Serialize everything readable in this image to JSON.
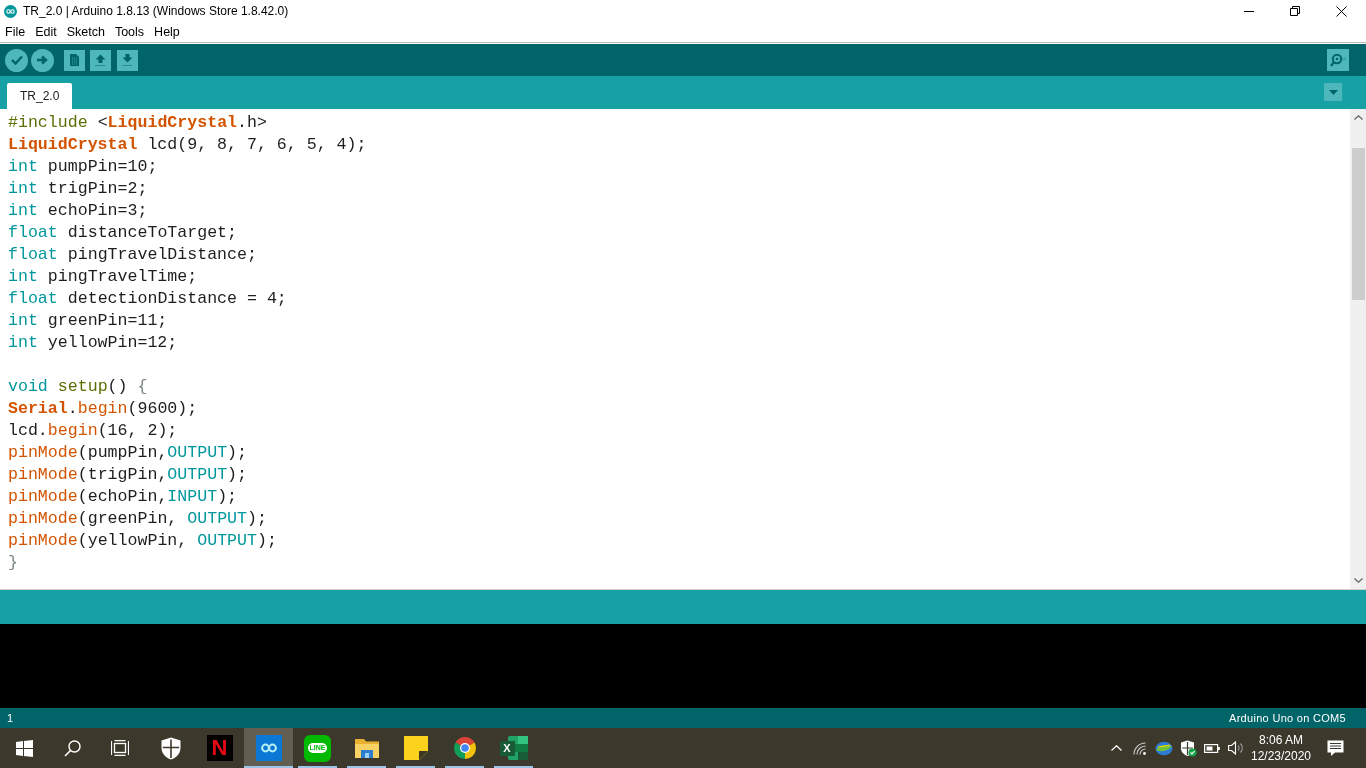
{
  "window": {
    "title": "TR_2.0 | Arduino 1.8.13 (Windows Store 1.8.42.0)"
  },
  "menu": [
    {
      "label": "File"
    },
    {
      "label": "Edit"
    },
    {
      "label": "Sketch"
    },
    {
      "label": "Tools"
    },
    {
      "label": "Help"
    }
  ],
  "tabs": [
    {
      "label": "TR_2.0",
      "selected": true
    }
  ],
  "editor": {
    "blocks": [
      {
        "lines": [
          {
            "tokens": [
              {
                "text": "#include",
                "kind": "directive"
              },
              {
                "text": " <",
                "kind": "plain"
              },
              {
                "text": "LiquidCrystal",
                "kind": "class"
              },
              {
                "text": ".h>",
                "kind": "plain"
              }
            ]
          },
          {
            "tokens": [
              {
                "text": "LiquidCrystal",
                "kind": "class"
              },
              {
                "text": " lcd(9, 8, 7, 6, 5, 4);",
                "kind": "plain"
              }
            ]
          },
          {
            "tokens": [
              {
                "text": "int",
                "kind": "type"
              },
              {
                "text": " pumpPin=10;",
                "kind": "plain"
              }
            ]
          },
          {
            "tokens": [
              {
                "text": "int",
                "kind": "type"
              },
              {
                "text": " trigPin=2;",
                "kind": "plain"
              }
            ]
          },
          {
            "tokens": [
              {
                "text": "int",
                "kind": "type"
              },
              {
                "text": " echoPin=3;",
                "kind": "plain"
              }
            ]
          },
          {
            "tokens": [
              {
                "text": "float",
                "kind": "type"
              },
              {
                "text": " distanceToTarget;",
                "kind": "plain"
              }
            ]
          },
          {
            "tokens": [
              {
                "text": "float",
                "kind": "type"
              },
              {
                "text": " pingTravelDistance;",
                "kind": "plain"
              }
            ]
          },
          {
            "tokens": [
              {
                "text": "int",
                "kind": "type"
              },
              {
                "text": " pingTravelTime;",
                "kind": "plain"
              }
            ]
          },
          {
            "tokens": [
              {
                "text": "float",
                "kind": "type"
              },
              {
                "text": " detectionDistance = 4;",
                "kind": "plain"
              }
            ]
          },
          {
            "tokens": [
              {
                "text": "int",
                "kind": "type"
              },
              {
                "text": " greenPin=11;",
                "kind": "plain"
              }
            ]
          },
          {
            "tokens": [
              {
                "text": "int",
                "kind": "type"
              },
              {
                "text": " yellowPin=12;",
                "kind": "plain"
              }
            ]
          }
        ]
      },
      {
        "lines": [
          {
            "tokens": [
              {
                "text": "void",
                "kind": "type"
              },
              {
                "text": " setup",
                "kind": "sketch_function"
              },
              {
                "text": "() ",
                "kind": "plain"
              },
              {
                "text": "{",
                "kind": "bracket"
              }
            ]
          },
          {
            "tokens": [
              {
                "text": "Serial",
                "kind": "class"
              },
              {
                "text": ".",
                "kind": "plain"
              },
              {
                "text": "begin",
                "kind": "function"
              },
              {
                "text": "(9600);",
                "kind": "plain"
              }
            ]
          },
          {
            "tokens": [
              {
                "text": "lcd.",
                "kind": "plain"
              },
              {
                "text": "begin",
                "kind": "function"
              },
              {
                "text": "(16, 2);",
                "kind": "plain"
              }
            ]
          },
          {
            "tokens": [
              {
                "text": "pinMode",
                "kind": "function"
              },
              {
                "text": "(pumpPin,",
                "kind": "plain"
              },
              {
                "text": "OUTPUT",
                "kind": "constant"
              },
              {
                "text": ");",
                "kind": "plain"
              }
            ]
          },
          {
            "tokens": [
              {
                "text": "pinMode",
                "kind": "function"
              },
              {
                "text": "(trigPin,",
                "kind": "plain"
              },
              {
                "text": "OUTPUT",
                "kind": "constant"
              },
              {
                "text": ");",
                "kind": "plain"
              }
            ]
          },
          {
            "tokens": [
              {
                "text": "pinMode",
                "kind": "function"
              },
              {
                "text": "(echoPin,",
                "kind": "plain"
              },
              {
                "text": "INPUT",
                "kind": "constant"
              },
              {
                "text": ");",
                "kind": "plain"
              }
            ]
          },
          {
            "tokens": [
              {
                "text": "pinMode",
                "kind": "function"
              },
              {
                "text": "(greenPin, ",
                "kind": "plain"
              },
              {
                "text": "OUTPUT",
                "kind": "constant"
              },
              {
                "text": ");",
                "kind": "plain"
              }
            ]
          },
          {
            "tokens": [
              {
                "text": "pinMode",
                "kind": "function"
              },
              {
                "text": "(yellowPin, ",
                "kind": "plain"
              },
              {
                "text": "OUTPUT",
                "kind": "constant"
              },
              {
                "text": ");",
                "kind": "plain"
              }
            ]
          },
          {
            "tokens": [
              {
                "text": "}",
                "kind": "bracket"
              }
            ]
          }
        ]
      }
    ]
  },
  "status_bar": {
    "line": "1",
    "board": "Arduino Uno on COM5"
  },
  "taskbar": {
    "apps": [
      {
        "kind": "shield",
        "selected": false,
        "running": false
      },
      {
        "kind": "letter",
        "label": "N",
        "selected": false,
        "running": false
      },
      {
        "kind": "infinity",
        "selected": true,
        "running": true
      },
      {
        "kind": "chat",
        "label": "LINE",
        "selected": false,
        "running": true
      },
      {
        "kind": "folder",
        "selected": false,
        "running": true
      },
      {
        "kind": "note",
        "selected": false,
        "running": true
      },
      {
        "kind": "sphere",
        "selected": false,
        "running": true
      },
      {
        "kind": "sheet",
        "label": "X",
        "selected": false,
        "running": true
      }
    ],
    "clock": {
      "time": "8:06 AM",
      "date": "12/23/2020"
    }
  }
}
